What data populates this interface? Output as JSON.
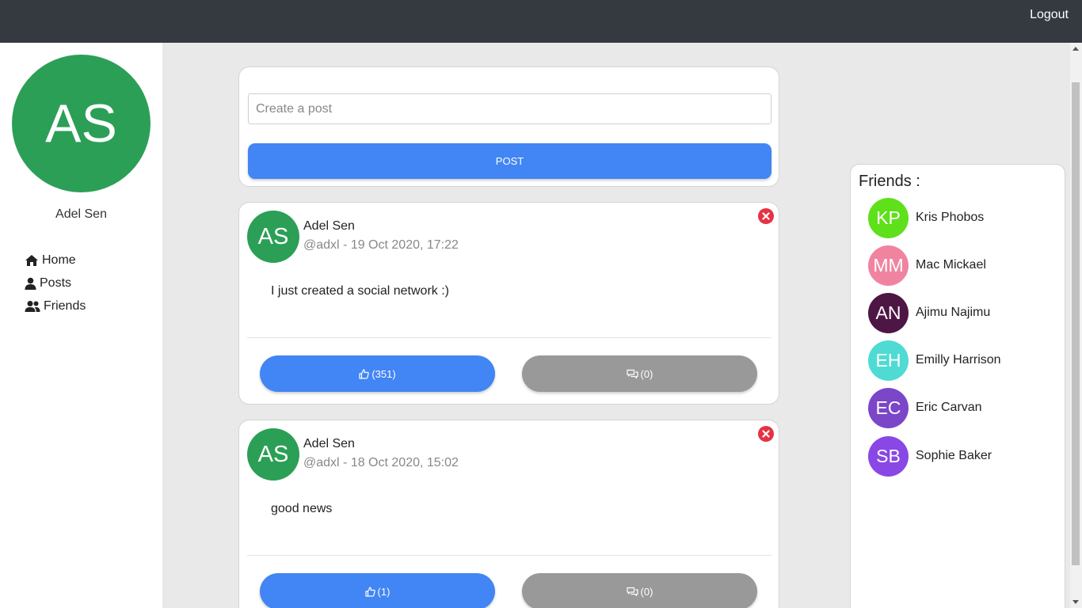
{
  "header": {
    "logout_label": "Logout"
  },
  "sidebar": {
    "avatar_initials": "AS",
    "user_name": "Adel Sen",
    "nav": [
      {
        "label": "Home",
        "icon": "home-icon"
      },
      {
        "label": "Posts",
        "icon": "user-icon"
      },
      {
        "label": "Friends",
        "icon": "users-icon"
      }
    ]
  },
  "composer": {
    "placeholder": "Create a post",
    "button_label": "POST"
  },
  "posts": [
    {
      "avatar_initials": "AS",
      "author": "Adel Sen",
      "meta": "@adxl - 19 Oct 2020, 17:22",
      "text": "I just created a social network :)",
      "likes_label": "(351)",
      "comments_label": "(0)"
    },
    {
      "avatar_initials": "AS",
      "author": "Adel Sen",
      "meta": "@adxl - 18 Oct 2020, 15:02",
      "text": "good news",
      "likes_label": "(1)",
      "comments_label": "(0)"
    }
  ],
  "friends": {
    "title": "Friends :",
    "list": [
      {
        "initials": "KP",
        "name": "Kris Phobos",
        "color": "#5ee01a"
      },
      {
        "initials": "MM",
        "name": "Mac Mickael",
        "color": "#f084a0"
      },
      {
        "initials": "AN",
        "name": "Ajimu Najimu",
        "color": "#4d1645"
      },
      {
        "initials": "EH",
        "name": "Emilly Harrison",
        "color": "#4fdbd3"
      },
      {
        "initials": "EC",
        "name": "Eric Carvan",
        "color": "#7b46c8"
      },
      {
        "initials": "SB",
        "name": "Sophie Baker",
        "color": "#8947e6"
      }
    ]
  },
  "colors": {
    "topbar": "#343a40",
    "primary": "#4285f4",
    "secondary": "#999999",
    "avatar_green": "#2b9f56",
    "danger": "#e53345"
  }
}
